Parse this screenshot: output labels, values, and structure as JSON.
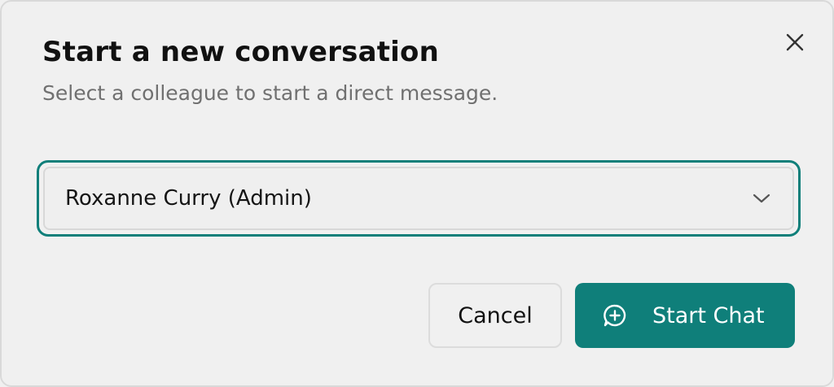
{
  "dialog": {
    "title": "Start a new conversation",
    "subtitle": "Select a colleague to start a direct message.",
    "close_icon": "close-icon"
  },
  "colleague_select": {
    "selected_value": "Roxanne Curry (Admin)",
    "icon": "chevron-down-icon"
  },
  "actions": {
    "cancel_label": "Cancel",
    "start_chat_label": "Start Chat",
    "start_chat_icon": "chat-plus-icon"
  },
  "colors": {
    "accent": "#0f7f7a",
    "background": "#f0f0f0",
    "title_text": "#111111",
    "subtitle_text": "#707070"
  }
}
